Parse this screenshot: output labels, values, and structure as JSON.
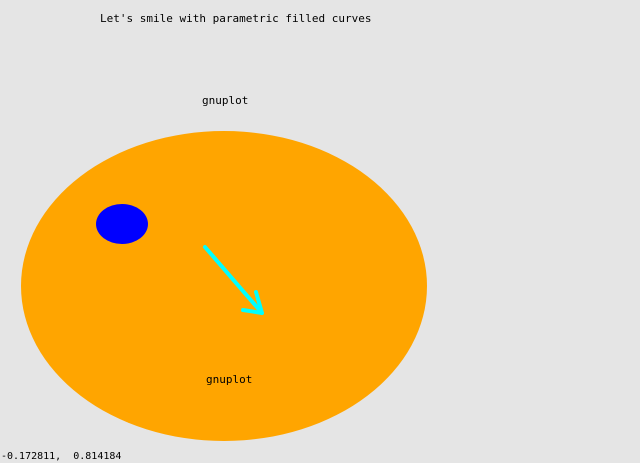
{
  "plot": {
    "title": "Let's smile with parametric filled curves",
    "labels": {
      "top": "gnuplot",
      "inner": "gnuplot"
    },
    "colors": {
      "background": "#e5e5e5",
      "face": "#ffa500",
      "eye": "#0000ff",
      "arrow": "#00ffff",
      "text": "#000000"
    }
  },
  "status": {
    "coordinates": "-0.172811,  0.814184"
  }
}
